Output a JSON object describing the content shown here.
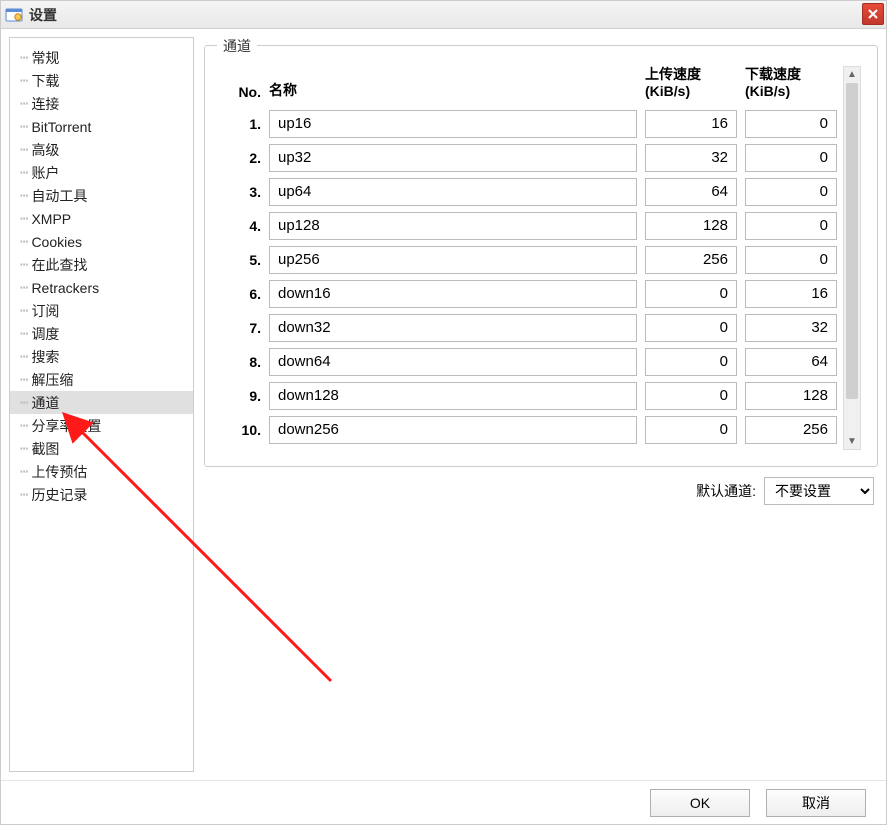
{
  "window": {
    "title": "设置"
  },
  "sidebar": {
    "items": [
      {
        "label": "常规"
      },
      {
        "label": "下载"
      },
      {
        "label": "连接"
      },
      {
        "label": "BitTorrent"
      },
      {
        "label": "高级"
      },
      {
        "label": "账户"
      },
      {
        "label": "自动工具"
      },
      {
        "label": "XMPP"
      },
      {
        "label": "Cookies"
      },
      {
        "label": "在此查找"
      },
      {
        "label": "Retrackers"
      },
      {
        "label": "订阅"
      },
      {
        "label": "调度"
      },
      {
        "label": "搜索"
      },
      {
        "label": "解压缩"
      },
      {
        "label": "通道",
        "selected": true
      },
      {
        "label": "分享率设置"
      },
      {
        "label": "截图"
      },
      {
        "label": "上传预估"
      },
      {
        "label": "历史记录"
      }
    ]
  },
  "group": {
    "title": "通道",
    "columns": {
      "no": "No.",
      "name": "名称",
      "up": "上传速度\n(KiB/s)",
      "down": "下载速度\n(KiB/s)"
    },
    "rows": [
      {
        "no": "1.",
        "name": "up16",
        "up": "16",
        "down": "0"
      },
      {
        "no": "2.",
        "name": "up32",
        "up": "32",
        "down": "0"
      },
      {
        "no": "3.",
        "name": "up64",
        "up": "64",
        "down": "0"
      },
      {
        "no": "4.",
        "name": "up128",
        "up": "128",
        "down": "0"
      },
      {
        "no": "5.",
        "name": "up256",
        "up": "256",
        "down": "0"
      },
      {
        "no": "6.",
        "name": "down16",
        "up": "0",
        "down": "16"
      },
      {
        "no": "7.",
        "name": "down32",
        "up": "0",
        "down": "32"
      },
      {
        "no": "8.",
        "name": "down64",
        "up": "0",
        "down": "64"
      },
      {
        "no": "9.",
        "name": "down128",
        "up": "0",
        "down": "128"
      },
      {
        "no": "10.",
        "name": "down256",
        "up": "0",
        "down": "256"
      }
    ]
  },
  "default_channel": {
    "label": "默认通道:",
    "selected": "不要设置"
  },
  "footer": {
    "ok": "OK",
    "cancel": "取消"
  }
}
